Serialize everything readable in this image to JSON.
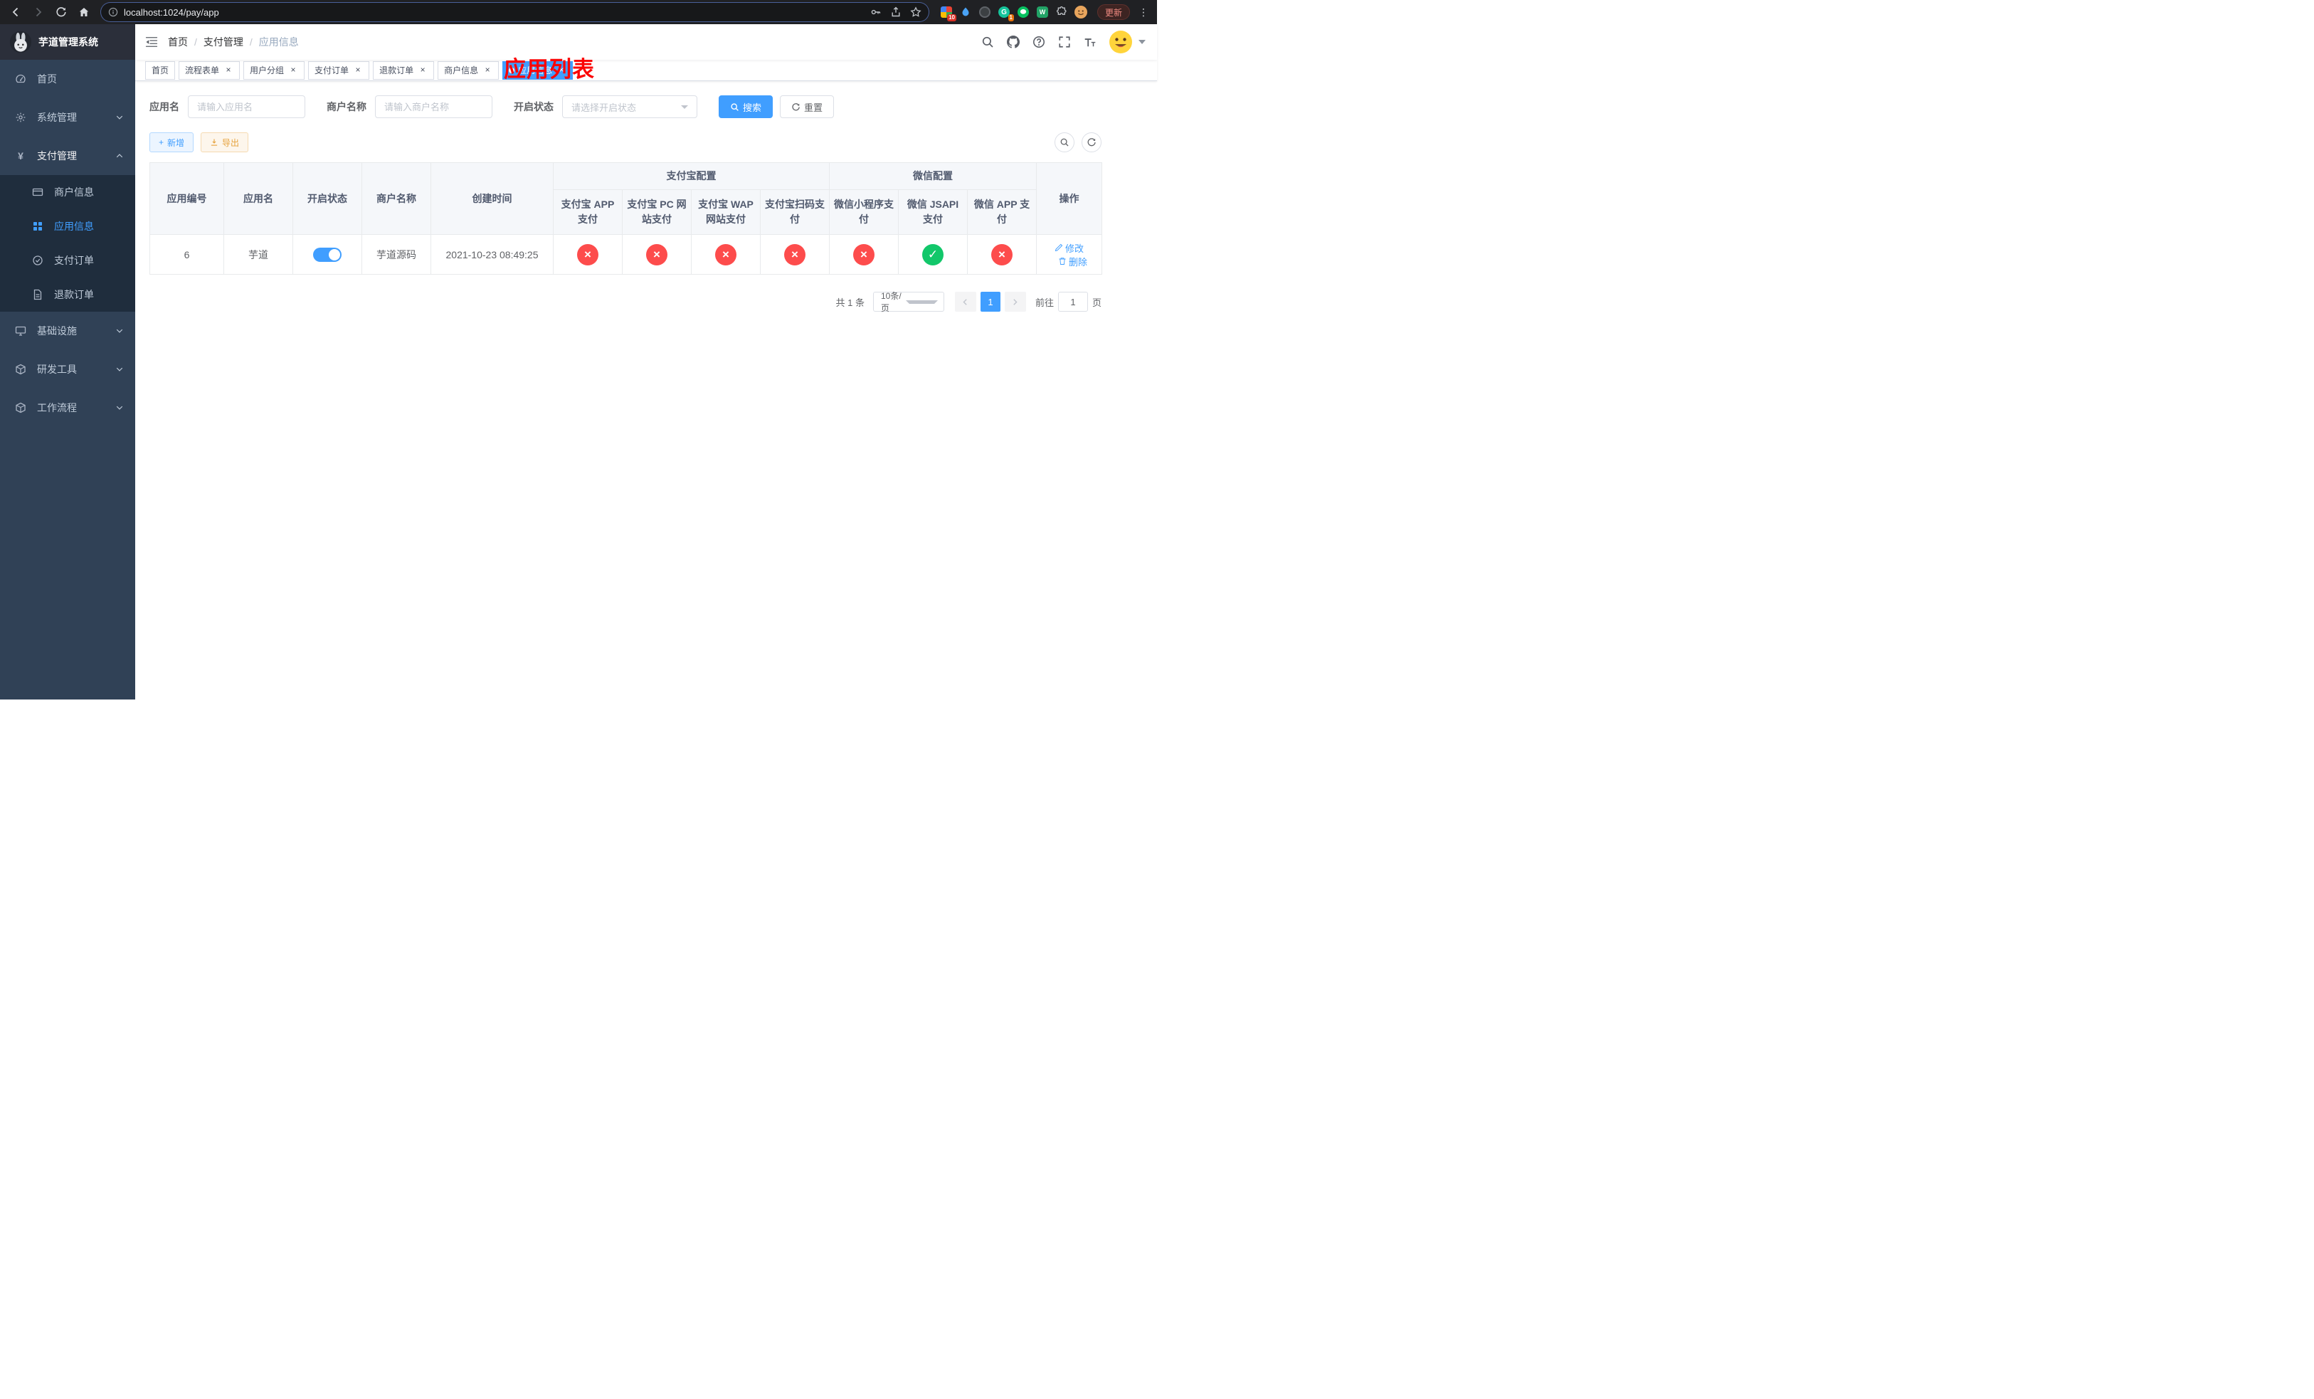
{
  "colors": {
    "accent": "#409eff",
    "success": "#12c76a",
    "danger": "#fd4c4c",
    "sidebar_bg": "#304156",
    "submenu_bg": "#1f2d3d",
    "annotation_red": "#fb0505"
  },
  "icons": {
    "tab_close": "×",
    "status_enabled": "✓",
    "status_disabled": "×",
    "add_plus": "+",
    "kebab_menu": "⋮"
  },
  "browser": {
    "url": "localhost:1024/pay/app",
    "update_label": "更新",
    "ext_badge_10": "10",
    "ext_badge_1": "1"
  },
  "sidebar": {
    "logo_title": "芋道管理系统",
    "items": [
      {
        "label": "首页"
      },
      {
        "label": "系统管理"
      },
      {
        "label": "支付管理"
      },
      {
        "label": "基础设施"
      },
      {
        "label": "研发工具"
      },
      {
        "label": "工作流程"
      }
    ],
    "pay_submenu": [
      {
        "label": "商户信息"
      },
      {
        "label": "应用信息"
      },
      {
        "label": "支付订单"
      },
      {
        "label": "退款订单"
      }
    ]
  },
  "header": {
    "breadcrumb": [
      "首页",
      "支付管理",
      "应用信息"
    ],
    "breadcrumb_separator": "/",
    "annotation": "应用列表"
  },
  "tabs": [
    {
      "label": "首页",
      "closable": false,
      "active": false
    },
    {
      "label": "流程表单",
      "closable": true,
      "active": false
    },
    {
      "label": "用户分组",
      "closable": true,
      "active": false
    },
    {
      "label": "支付订单",
      "closable": true,
      "active": false
    },
    {
      "label": "退款订单",
      "closable": true,
      "active": false
    },
    {
      "label": "商户信息",
      "closable": true,
      "active": false
    },
    {
      "label": "应用信息",
      "closable": true,
      "active": true
    }
  ],
  "filters": {
    "app_name_label": "应用名",
    "app_name_placeholder": "请输入应用名",
    "merchant_label": "商户名称",
    "merchant_placeholder": "请输入商户名称",
    "status_label": "开启状态",
    "status_placeholder": "请选择开启状态",
    "search_label": "搜索",
    "reset_label": "重置"
  },
  "toolbar": {
    "add_label": "新增",
    "export_label": "导出"
  },
  "table": {
    "headers": {
      "app_id": "应用编号",
      "app_name": "应用名",
      "status": "开启状态",
      "merchant": "商户名称",
      "create_time": "创建时间",
      "alipay_group": "支付宝配置",
      "wechat_group": "微信配置",
      "alipay_app": "支付宝 APP 支付",
      "alipay_pc": "支付宝 PC 网站支付",
      "alipay_wap": "支付宝 WAP 网站支付",
      "alipay_qr": "支付宝扫码支付",
      "wechat_lite": "微信小程序支付",
      "wechat_jsapi": "微信 JSAPI 支付",
      "wechat_app": "微信 APP 支付",
      "actions": "操作"
    },
    "rows": [
      {
        "app_id": "6",
        "app_name": "芋道",
        "enabled": true,
        "merchant": "芋道源码",
        "create_time": "2021-10-23 08:49:25",
        "alipay_app": false,
        "alipay_pc": false,
        "alipay_wap": false,
        "alipay_qr": false,
        "wechat_lite": false,
        "wechat_jsapi": true,
        "wechat_app": false,
        "edit_label": "修改",
        "delete_label": "删除"
      }
    ]
  },
  "pagination": {
    "total_text": "共 1 条",
    "page_size": "10条/页",
    "page": "1",
    "goto_label": "前往",
    "goto_value": "1",
    "page_unit": "页"
  }
}
